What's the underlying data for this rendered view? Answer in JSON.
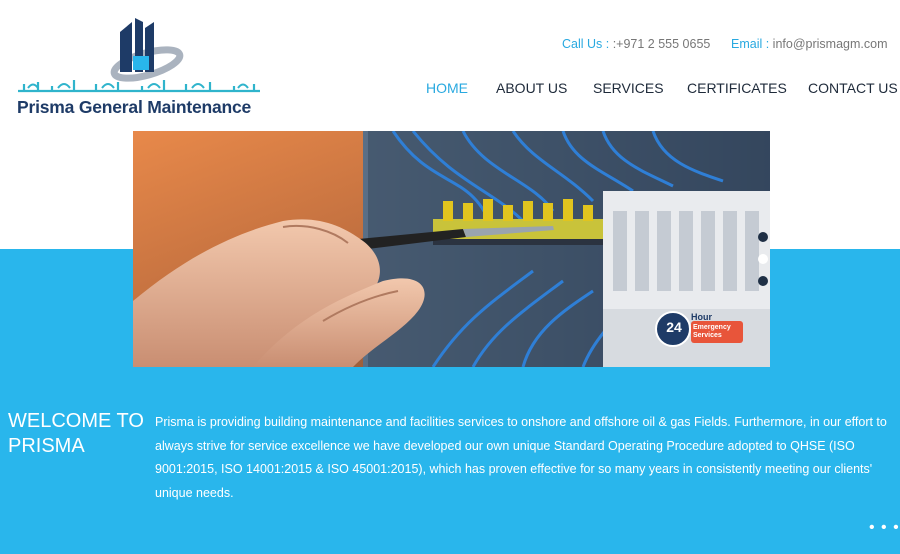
{
  "header": {
    "logo_text": "Prisma General Maintenance",
    "logo_arabic": "بريسما للصيانة العامة",
    "contact": {
      "call_label": "Call Us :",
      "call_value": " :+971 2 555 0655",
      "email_label": "Email :",
      "email_value": " info@prismagm.com"
    },
    "nav": [
      {
        "label": "HOME",
        "active": true
      },
      {
        "label": "ABOUT US"
      },
      {
        "label": "SERVICES"
      },
      {
        "label": "CERTIFICATES"
      },
      {
        "label": "CONTACT US"
      }
    ]
  },
  "hero": {
    "badge_number": "24",
    "badge_word": "Hour",
    "badge_text": "Emergency Services",
    "slide_count": 3,
    "active_slide": 2
  },
  "welcome": {
    "title": "WELCOME TO PRISMA",
    "body": "Prisma is providing building maintenance and facilities services to onshore and offshore oil & gas Fields. Furthermore, in our effort to always strive for service excellence we have developed our own unique Standard Operating Procedure adopted to QHSE (ISO 9001:2015, ISO 14001:2015 & ISO 45001:2015), which has proven effective for so many years in consistently meeting our clients' unique needs.",
    "more": "• • •"
  },
  "colors": {
    "accent": "#29b6ec",
    "link": "#29a9e0",
    "navy": "#1e3b67"
  }
}
